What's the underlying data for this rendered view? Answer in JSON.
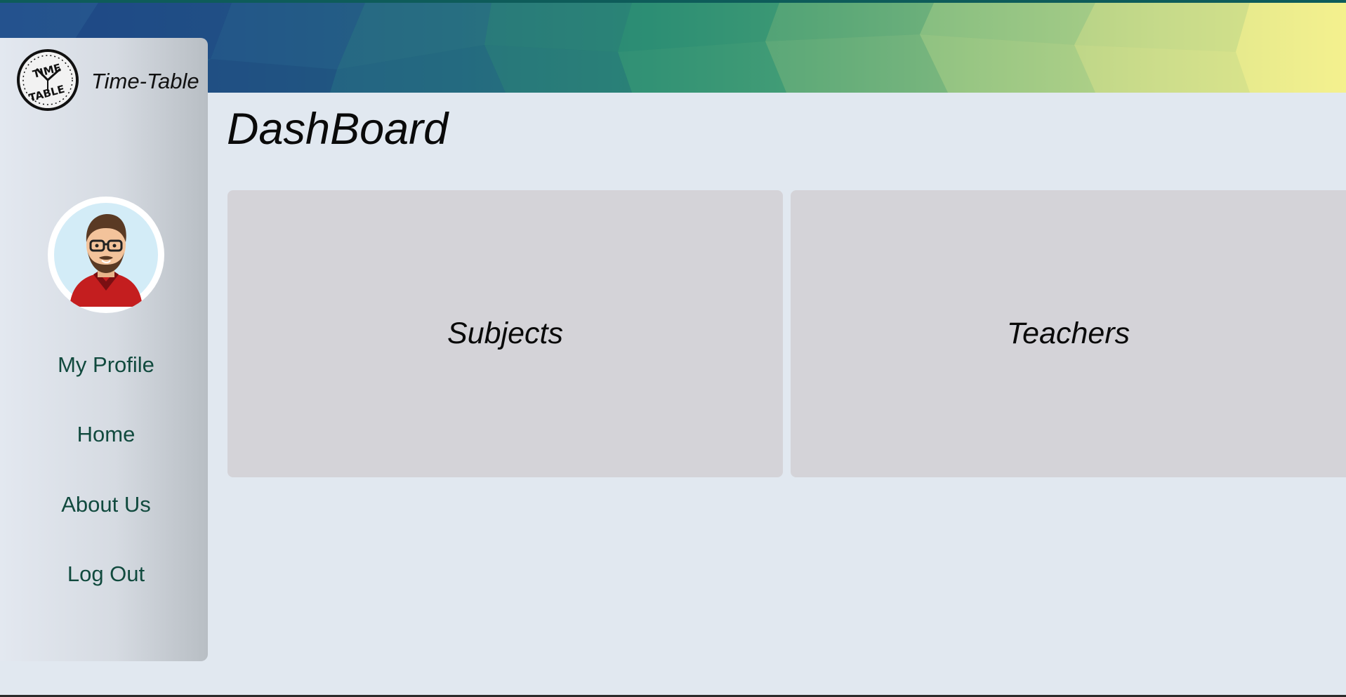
{
  "app": {
    "brand": "Time-Table",
    "logo_text_top": "TIME",
    "logo_text_bottom": "TABLE",
    "logo_icon": "clock-logo-icon"
  },
  "sidebar": {
    "avatar_icon": "user-avatar-icon",
    "items": [
      {
        "label": "My Profile"
      },
      {
        "label": "Home"
      },
      {
        "label": "About Us"
      },
      {
        "label": "Log Out"
      }
    ]
  },
  "main": {
    "title": "DashBoard",
    "cards": [
      {
        "label": "Subjects"
      },
      {
        "label": "Teachers"
      }
    ]
  },
  "colors": {
    "background": "#e1e8f0",
    "card": "#d4d3d8",
    "nav_text": "#114a3e",
    "banner_start": "#1f4a8a",
    "banner_end": "#f3f08c"
  }
}
